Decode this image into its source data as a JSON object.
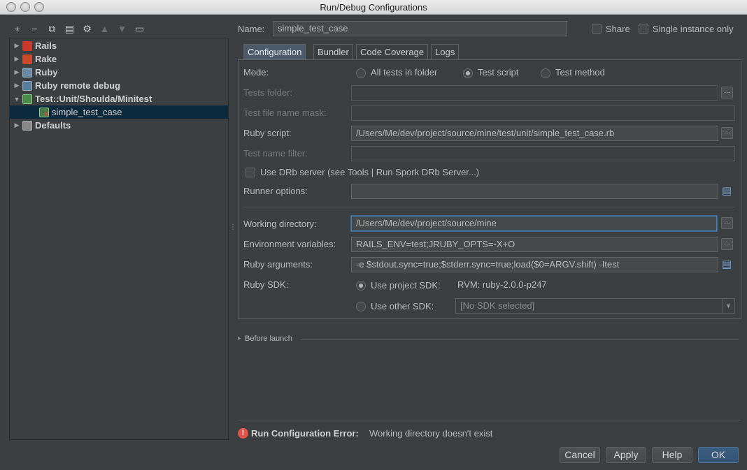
{
  "window": {
    "title": "Run/Debug Configurations"
  },
  "toolbar": {
    "add": "+",
    "remove": "−",
    "copy": "⧉",
    "save": "▤",
    "edit_defaults": "⚙",
    "move_up": "▲",
    "move_down": "▼",
    "folder": "▭"
  },
  "tree": {
    "items": [
      {
        "label": "Rails",
        "arrow": "▶",
        "icon": "rails-icon"
      },
      {
        "label": "Rake",
        "arrow": "▶",
        "icon": "rake-icon"
      },
      {
        "label": "Ruby",
        "arrow": "▶",
        "icon": "ruby-icon"
      },
      {
        "label": "Ruby remote debug",
        "arrow": "▶",
        "icon": "ruby-remote-debug-icon"
      },
      {
        "label": "Test::Unit/Shoulda/Minitest",
        "arrow": "▼",
        "icon": "test-unit-icon"
      },
      {
        "label": "simple_test_case",
        "arrow": "",
        "icon": "test-case-error-icon"
      },
      {
        "label": "Defaults",
        "arrow": "▶",
        "icon": "defaults-icon"
      }
    ]
  },
  "header": {
    "name_label": "Name:",
    "name_value": "simple_test_case",
    "share_label": "Share",
    "single_instance_label": "Single instance only"
  },
  "tabs": [
    "Configuration",
    "Bundler",
    "Code Coverage",
    "Logs"
  ],
  "config": {
    "mode_label": "Mode:",
    "mode_options": [
      "All tests in folder",
      "Test script",
      "Test method"
    ],
    "mode_selected": "Test script",
    "tests_folder_label": "Tests folder:",
    "tests_folder_value": "",
    "mask_label": "Test file name mask:",
    "mask_value": "",
    "ruby_script_label": "Ruby script:",
    "ruby_script_value": "/Users/Me/dev/project/source/mine/test/unit/simple_test_case.rb",
    "name_filter_label": "Test name filter:",
    "name_filter_value": "",
    "drb_label": "Use DRb server (see Tools | Run Spork DRb Server...)",
    "runner_options_label": "Runner options:",
    "runner_options_value": "",
    "working_dir_label": "Working directory:",
    "working_dir_value": "/Users/Me/dev/project/source/mine",
    "env_vars_label": "Environment variables:",
    "env_vars_value": "RAILS_ENV=test;JRUBY_OPTS=-X+O",
    "ruby_args_label": "Ruby arguments:",
    "ruby_args_value": "-e $stdout.sync=true;$stderr.sync=true;load($0=ARGV.shift) -Itest",
    "ruby_sdk_label": "Ruby SDK:",
    "use_project_sdk_label": "Use project SDK:",
    "project_sdk_value": "RVM: ruby-2.0.0-p247",
    "use_other_sdk_label": "Use other SDK:",
    "other_sdk_value": "[No SDK selected]",
    "ellipsis": "...",
    "expand": "▤"
  },
  "before_launch": {
    "label": "Before launch",
    "arrow": "▸"
  },
  "error": {
    "icon": "!",
    "title": "Run Configuration Error:",
    "message": "Working directory doesn't exist"
  },
  "buttons": {
    "cancel": "Cancel",
    "apply": "Apply",
    "help": "Help",
    "ok": "OK"
  }
}
